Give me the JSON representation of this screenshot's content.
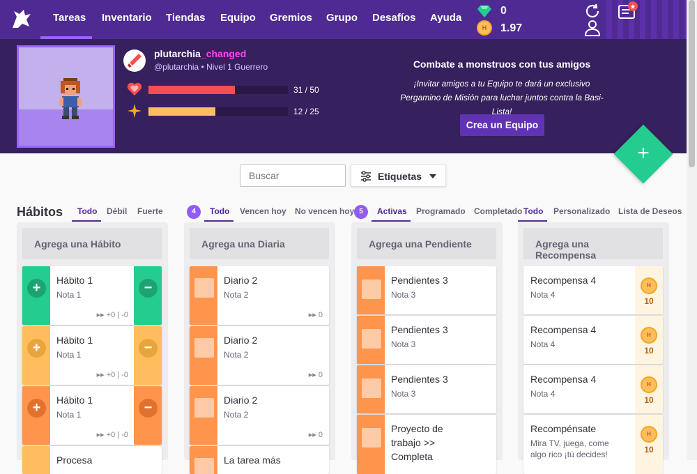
{
  "nav": {
    "items": [
      {
        "label": "Tareas"
      },
      {
        "label": "Inventario"
      },
      {
        "label": "Tiendas"
      },
      {
        "label": "Equipo"
      },
      {
        "label": "Gremios"
      },
      {
        "label": "Grupo"
      },
      {
        "label": "Desafíos"
      },
      {
        "label": "Ayuda"
      }
    ],
    "gems": "0",
    "gold": "1.97"
  },
  "header": {
    "username": "plutarchia",
    "username_suffix": "_changed",
    "handle_level": "@plutarchia • Nivel 1 Guerrero",
    "health": {
      "label": "31 / 50",
      "value": 31,
      "max": 50
    },
    "experience": {
      "label": "12 / 25",
      "value": 12,
      "max": 25
    },
    "party_title": "Combate a monstruos con tus amigos",
    "party_text_1": "¡Invitar amigos a tu Equipo te dará un exclusivo",
    "party_text_2": "Pergamino de Misión para luchar juntos contra la Basi-Lista!",
    "party_button": "Crea un Equipo"
  },
  "toolbar": {
    "search_placeholder": "Buscar",
    "tags_label": "Etiquetas"
  },
  "habits": {
    "title": "Hábitos",
    "filters": [
      "Todo",
      "Débil",
      "Fuerte"
    ],
    "add_label": "Agrega una Hábito",
    "items": [
      {
        "title": "Hábito 1",
        "note": "Nota 1",
        "meta": "▸▸ +0 | -0"
      },
      {
        "title": "Hábito 1",
        "note": "Nota 1",
        "meta": "▸▸ +0 | -0"
      },
      {
        "title": "Hábito 1",
        "note": "Nota 1",
        "meta": "▸▸ +0 | -0"
      },
      {
        "title": "Procesa"
      }
    ]
  },
  "dailies": {
    "badge": "4",
    "filters": [
      "Todo",
      "Vencen hoy",
      "No vencen hoy"
    ],
    "add_label": "Agrega una Diaria",
    "items": [
      {
        "title": "Diario 2",
        "note": "Nota 2",
        "meta": "▸▸ 0"
      },
      {
        "title": "Diario 2",
        "note": "Nota 2",
        "meta": "▸▸ 0"
      },
      {
        "title": "Diario 2",
        "note": "Nota 2",
        "meta": "▸▸ 0"
      },
      {
        "title": "La tarea más"
      }
    ]
  },
  "todos": {
    "badge": "5",
    "filters": [
      "Activas",
      "Programado",
      "Completado"
    ],
    "add_label": "Agrega una Pendiente",
    "items": [
      {
        "title": "Pendientes 3",
        "note": "Nota 3"
      },
      {
        "title": "Pendientes 3",
        "note": "Nota 3"
      },
      {
        "title": "Pendientes 3",
        "note": "Nota 3"
      },
      {
        "title": "Proyecto de trabajo >> Completa"
      }
    ]
  },
  "rewards": {
    "filters": [
      "Todo",
      "Personalizado",
      "Lista de Deseos"
    ],
    "add_label": "Agrega una Recompensa",
    "items": [
      {
        "title": "Recompensa 4",
        "note": "Nota 4",
        "value": "10"
      },
      {
        "title": "Recompensa 4",
        "note": "Nota 4",
        "value": "10"
      },
      {
        "title": "Recompensa 4",
        "note": "Nota 4",
        "value": "10"
      },
      {
        "title": "Recompénsate",
        "note": "Mira TV, juega, come algo rico ¡tú decides!",
        "value": "10"
      }
    ]
  },
  "colors": {
    "nav": "#4f2a93",
    "header": "#36205d",
    "green": "#24cc8f",
    "yellow": "#ffbe5d",
    "orange": "#ff944c",
    "health": "#f74e52",
    "experience": "#ffbe5d"
  }
}
